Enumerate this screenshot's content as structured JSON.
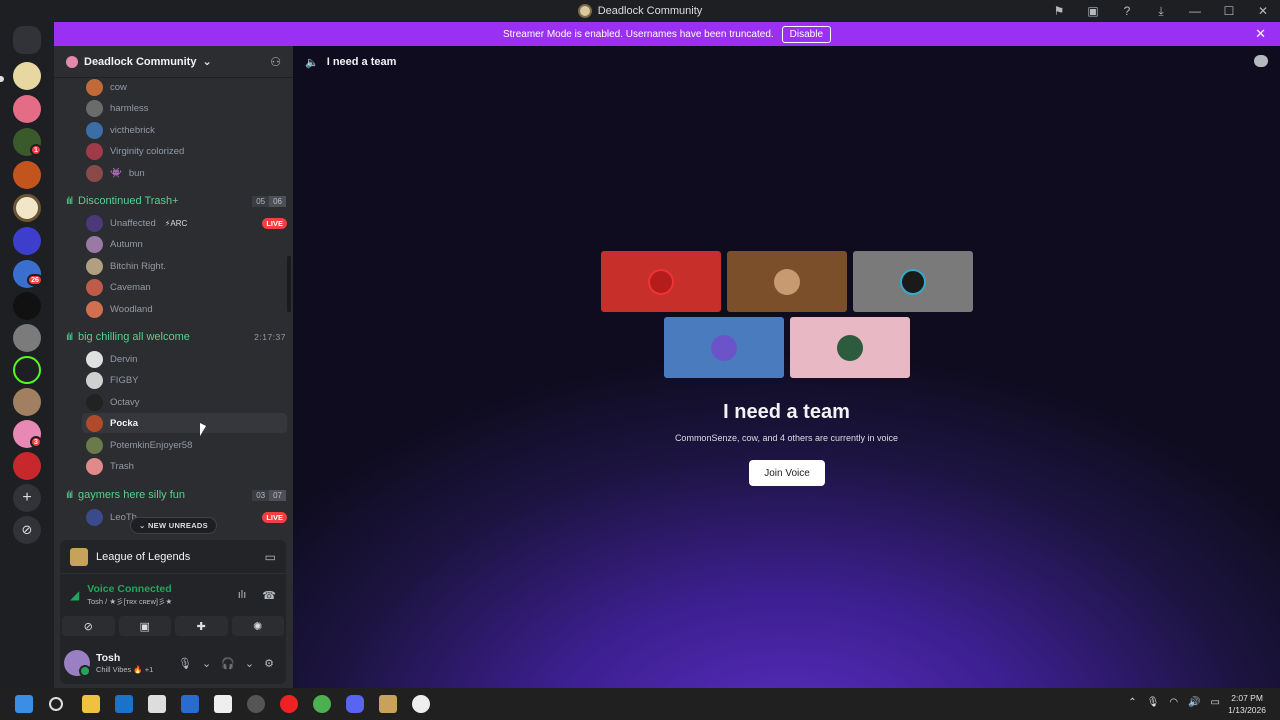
{
  "window": {
    "title": "Deadlock Community"
  },
  "banner": {
    "message": "Streamer Mode is enabled. Usernames have been truncated.",
    "disable_label": "Disable"
  },
  "servers": {
    "badges": {
      "s3": "1",
      "s6": "",
      "s9": "26",
      "s14": "3"
    }
  },
  "sidebar": {
    "guild_name": "Deadlock Community",
    "users_top": [
      "cow",
      "harmless",
      "victhebrick",
      "Virginity colorized",
      "bun"
    ],
    "channel1": {
      "name": "Discontinued Trash+",
      "count_a": "05",
      "count_b": "06"
    },
    "channel1_users": [
      "Unaffected",
      "Autumn",
      "Bitchin Right.",
      "Caveman",
      "Woodland"
    ],
    "arc_tag": "⚡ARC",
    "live_label": "LIVE",
    "channel2": {
      "name": "big chilling all welcome",
      "timer": "2:17:37"
    },
    "channel2_users": [
      "Dervin",
      "FIGBY",
      "Octavy",
      "Pocka",
      "PotemkinEnjoyer58",
      "Trash"
    ],
    "channel3": {
      "name": "gaymers here silly fun",
      "count_a": "03",
      "count_b": "07"
    },
    "channel3_users": [
      "LeoTh"
    ],
    "new_unreads": "⌄ NEW UNREADS"
  },
  "panel": {
    "activity": "League of Legends",
    "voice_status": "Voice Connected",
    "voice_sub": "Tosh / ★彡[ᴛʀx ᴄʀᴇᴡ]彡★",
    "user_name": "Tosh",
    "user_status": "Chill Vibes 🔥 +1"
  },
  "main": {
    "channel_name": "I need a team",
    "title": "I need a team",
    "desc": "CommonSenze, cow, and 4 others are currently in voice",
    "join_label": "Join Voice"
  },
  "taskbar": {
    "time": "2:07 PM",
    "date": "1/13/2026"
  },
  "colors": {
    "streamer_banner": "#9b30f5",
    "voice_green": "#23a55a",
    "live_red": "#f23f43",
    "channel_green": "#56d18b"
  }
}
